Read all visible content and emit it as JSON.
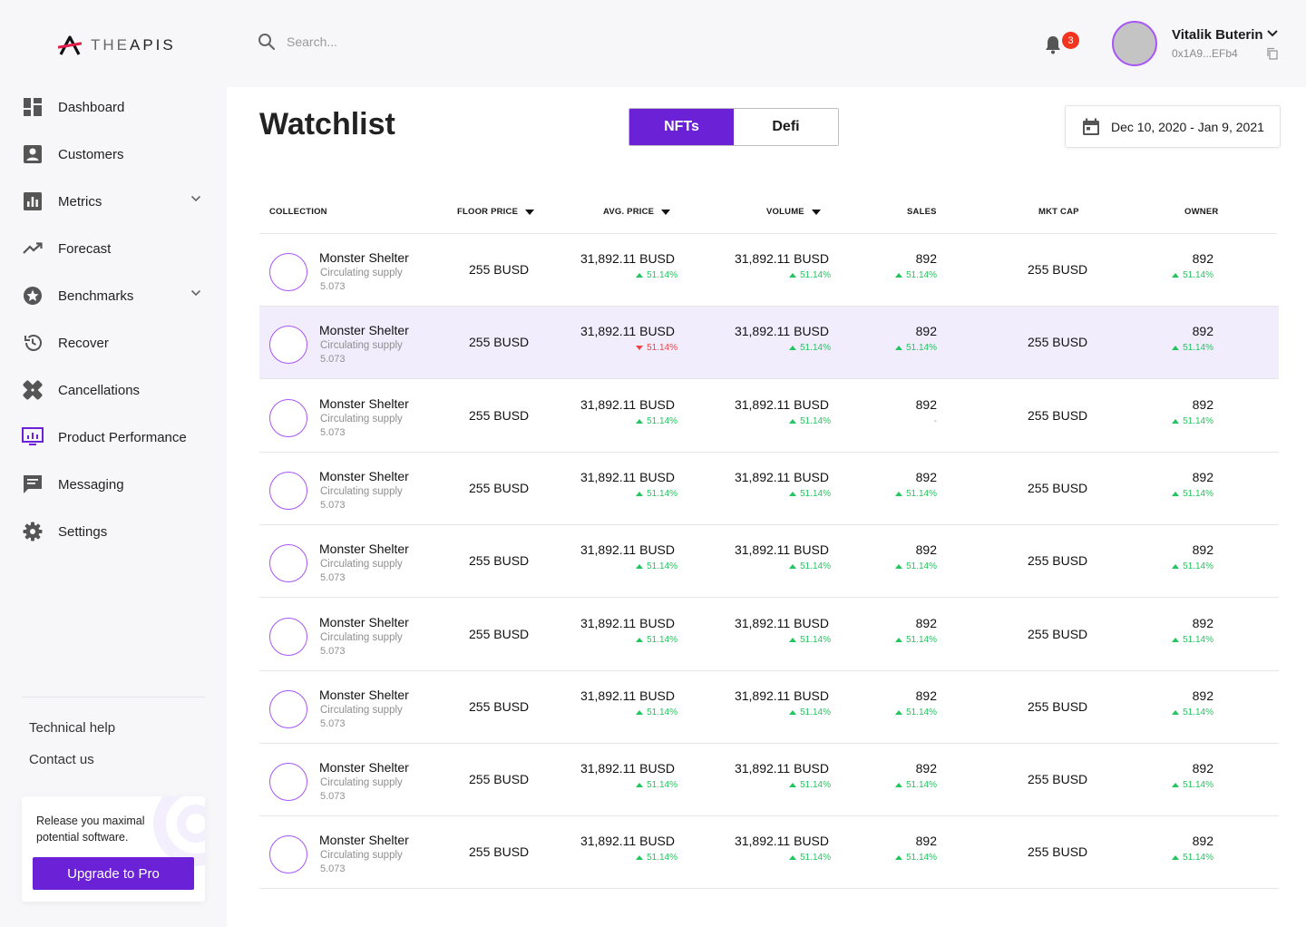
{
  "brand": {
    "logo_text_the": "THE",
    "logo_text_apis": "APIS",
    "accent": "#6b21d6",
    "up_color": "#22c55e",
    "down_color": "#ef4444",
    "badge_color": "#f2331d"
  },
  "header": {
    "search_placeholder": "Search...",
    "notification_count": "3",
    "user_name": "Vitalik Buterin",
    "user_address": "0x1A9...EFb4"
  },
  "sidebar": {
    "items": [
      {
        "label": "Dashboard",
        "icon": "dashboard-icon",
        "has_chevron": false
      },
      {
        "label": "Customers",
        "icon": "customers-icon",
        "has_chevron": false
      },
      {
        "label": "Metrics",
        "icon": "metrics-icon",
        "has_chevron": true
      },
      {
        "label": "Forecast",
        "icon": "forecast-icon",
        "has_chevron": false
      },
      {
        "label": "Benchmarks",
        "icon": "benchmarks-icon",
        "has_chevron": true
      },
      {
        "label": "Recover",
        "icon": "recover-icon",
        "has_chevron": false
      },
      {
        "label": "Cancellations",
        "icon": "cancellations-icon",
        "has_chevron": false
      },
      {
        "label": "Product Performance",
        "icon": "product-performance-icon",
        "has_chevron": false
      },
      {
        "label": "Messaging",
        "icon": "messaging-icon",
        "has_chevron": false
      },
      {
        "label": "Settings",
        "icon": "settings-icon",
        "has_chevron": false
      }
    ],
    "help_links": [
      "Technical help",
      "Contact us"
    ],
    "promo": {
      "text": "Release you maximal potential software.",
      "button_label": "Upgrade to Pro"
    }
  },
  "main": {
    "title": "Watchlist",
    "tabs": [
      {
        "label": "NFTs",
        "active": true
      },
      {
        "label": "Defi",
        "active": false
      }
    ],
    "date_range": "Dec 10, 2020 - Jan 9, 2021",
    "columns": [
      "COLLECTION",
      "FLOOR PRICE",
      "AVG. PRICE",
      "VOLUME",
      "SALES",
      "MKT CAP",
      "OWNER"
    ],
    "rows": [
      {
        "name": "Monster Shelter",
        "sub": "Circulating supply",
        "supply": "5.073",
        "floor": "255 BUSD",
        "avg": "31,892.11 BUSD",
        "avg_chg": "51.14%",
        "avg_dir": "up",
        "volume": "31,892.11 BUSD",
        "vol_chg": "51.14%",
        "vol_dir": "up",
        "sales": "892",
        "sales_chg": "51.14%",
        "sales_dir": "up",
        "mktcap": "255 BUSD",
        "owner": "892",
        "owner_chg": "51.14%",
        "owner_dir": "up",
        "highlight": false
      },
      {
        "name": "Monster Shelter",
        "sub": "Circulating supply",
        "supply": "5.073",
        "floor": "255 BUSD",
        "avg": "31,892.11 BUSD",
        "avg_chg": "51.14%",
        "avg_dir": "down",
        "volume": "31,892.11 BUSD",
        "vol_chg": "51.14%",
        "vol_dir": "up",
        "sales": "892",
        "sales_chg": "51.14%",
        "sales_dir": "up",
        "mktcap": "255 BUSD",
        "owner": "892",
        "owner_chg": "51.14%",
        "owner_dir": "up",
        "highlight": true
      },
      {
        "name": "Monster Shelter",
        "sub": "Circulating supply",
        "supply": "5.073",
        "floor": "255 BUSD",
        "avg": "31,892.11 BUSD",
        "avg_chg": "51.14%",
        "avg_dir": "up",
        "volume": "31,892.11 BUSD",
        "vol_chg": "51.14%",
        "vol_dir": "up",
        "sales": "892",
        "sales_chg": "-",
        "sales_dir": "flat",
        "mktcap": "255 BUSD",
        "owner": "892",
        "owner_chg": "51.14%",
        "owner_dir": "up",
        "highlight": false
      },
      {
        "name": "Monster Shelter",
        "sub": "Circulating supply",
        "supply": "5.073",
        "floor": "255 BUSD",
        "avg": "31,892.11 BUSD",
        "avg_chg": "51.14%",
        "avg_dir": "up",
        "volume": "31,892.11 BUSD",
        "vol_chg": "51.14%",
        "vol_dir": "up",
        "sales": "892",
        "sales_chg": "51.14%",
        "sales_dir": "up",
        "mktcap": "255 BUSD",
        "owner": "892",
        "owner_chg": "51.14%",
        "owner_dir": "up",
        "highlight": false
      },
      {
        "name": "Monster Shelter",
        "sub": "Circulating supply",
        "supply": "5.073",
        "floor": "255 BUSD",
        "avg": "31,892.11 BUSD",
        "avg_chg": "51.14%",
        "avg_dir": "up",
        "volume": "31,892.11 BUSD",
        "vol_chg": "51.14%",
        "vol_dir": "up",
        "sales": "892",
        "sales_chg": "51.14%",
        "sales_dir": "up",
        "mktcap": "255 BUSD",
        "owner": "892",
        "owner_chg": "51.14%",
        "owner_dir": "up",
        "highlight": false
      },
      {
        "name": "Monster Shelter",
        "sub": "Circulating supply",
        "supply": "5.073",
        "floor": "255 BUSD",
        "avg": "31,892.11 BUSD",
        "avg_chg": "51.14%",
        "avg_dir": "up",
        "volume": "31,892.11 BUSD",
        "vol_chg": "51.14%",
        "vol_dir": "up",
        "sales": "892",
        "sales_chg": "51.14%",
        "sales_dir": "up",
        "mktcap": "255 BUSD",
        "owner": "892",
        "owner_chg": "51.14%",
        "owner_dir": "up",
        "highlight": false
      },
      {
        "name": "Monster Shelter",
        "sub": "Circulating supply",
        "supply": "5.073",
        "floor": "255 BUSD",
        "avg": "31,892.11 BUSD",
        "avg_chg": "51.14%",
        "avg_dir": "up",
        "volume": "31,892.11 BUSD",
        "vol_chg": "51.14%",
        "vol_dir": "up",
        "sales": "892",
        "sales_chg": "51.14%",
        "sales_dir": "up",
        "mktcap": "255 BUSD",
        "owner": "892",
        "owner_chg": "51.14%",
        "owner_dir": "up",
        "highlight": false
      },
      {
        "name": "Monster Shelter",
        "sub": "Circulating supply",
        "supply": "5.073",
        "floor": "255 BUSD",
        "avg": "31,892.11 BUSD",
        "avg_chg": "51.14%",
        "avg_dir": "up",
        "volume": "31,892.11 BUSD",
        "vol_chg": "51.14%",
        "vol_dir": "up",
        "sales": "892",
        "sales_chg": "51.14%",
        "sales_dir": "up",
        "mktcap": "255 BUSD",
        "owner": "892",
        "owner_chg": "51.14%",
        "owner_dir": "up",
        "highlight": false
      },
      {
        "name": "Monster Shelter",
        "sub": "Circulating supply",
        "supply": "5.073",
        "floor": "255 BUSD",
        "avg": "31,892.11 BUSD",
        "avg_chg": "51.14%",
        "avg_dir": "up",
        "volume": "31,892.11 BUSD",
        "vol_chg": "51.14%",
        "vol_dir": "up",
        "sales": "892",
        "sales_chg": "51.14%",
        "sales_dir": "up",
        "mktcap": "255 BUSD",
        "owner": "892",
        "owner_chg": "51.14%",
        "owner_dir": "up",
        "highlight": false
      }
    ]
  }
}
